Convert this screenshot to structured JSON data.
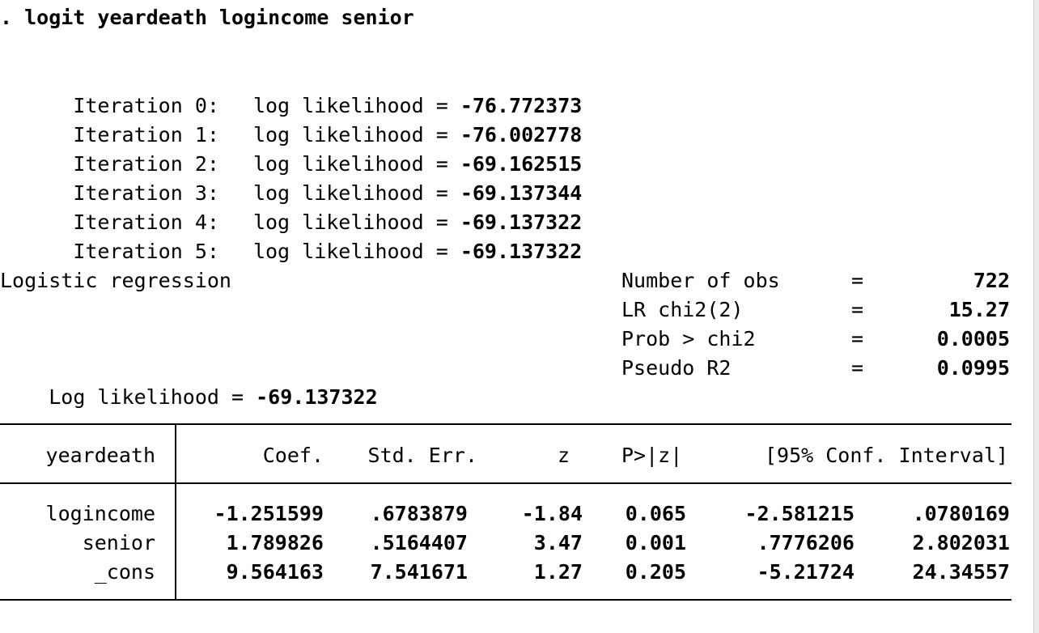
{
  "command": ". logit yeardeath logincome senior",
  "iterations": [
    {
      "label": "Iteration 0:",
      "text": "log likelihood =",
      "value": "-76.772373"
    },
    {
      "label": "Iteration 1:",
      "text": "log likelihood =",
      "value": "-76.002778"
    },
    {
      "label": "Iteration 2:",
      "text": "log likelihood =",
      "value": "-69.162515"
    },
    {
      "label": "Iteration 3:",
      "text": "log likelihood =",
      "value": "-69.137344"
    },
    {
      "label": "Iteration 4:",
      "text": "log likelihood =",
      "value": "-69.137322"
    },
    {
      "label": "Iteration 5:",
      "text": "log likelihood =",
      "value": "-69.137322"
    }
  ],
  "model_title": "Logistic regression",
  "loglik_label": "Log likelihood =",
  "loglik_value": "-69.137322",
  "stats": [
    {
      "label": "Number of obs",
      "eq": "=",
      "value": "722"
    },
    {
      "label": "LR chi2(2)",
      "eq": "=",
      "value": "15.27"
    },
    {
      "label": "Prob > chi2",
      "eq": "=",
      "value": "0.0005"
    },
    {
      "label": "Pseudo R2",
      "eq": "=",
      "value": "0.0995"
    }
  ],
  "table": {
    "depvar": "yeardeath",
    "headers": [
      "Coef.",
      "Std. Err.",
      "z",
      "P>|z|",
      "[95% Conf. Interval]"
    ],
    "rows": [
      {
        "name": "logincome",
        "coef": "-1.251599",
        "se": ".6783879",
        "z": "-1.84",
        "p": "0.065",
        "lo": "-2.581215",
        "hi": ".0780169"
      },
      {
        "name": "senior",
        "coef": "1.789826",
        "se": ".5164407",
        "z": "3.47",
        "p": "0.001",
        "lo": ".7776206",
        "hi": "2.802031"
      },
      {
        "name": "_cons",
        "coef": "9.564163",
        "se": "7.541671",
        "z": "1.27",
        "p": "0.205",
        "lo": "-5.21724",
        "hi": "24.34557"
      }
    ]
  }
}
